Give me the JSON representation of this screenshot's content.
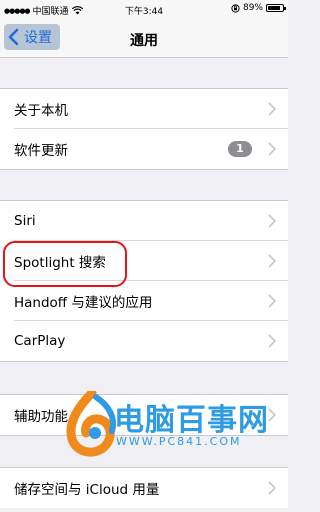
{
  "status_bar": {
    "signal_dots": "●●●●●",
    "carrier": "中国联通",
    "time": "下午3:44",
    "battery_percent": "89%",
    "battery_level": 0.89
  },
  "nav": {
    "back_label": "设置",
    "title": "通用"
  },
  "groups": [
    {
      "items": [
        {
          "label": "关于本机"
        },
        {
          "label": "软件更新",
          "badge": "1"
        }
      ]
    },
    {
      "items": [
        {
          "label": "Siri"
        },
        {
          "label": "Spotlight 搜索"
        },
        {
          "label": "Handoff 与建议的应用"
        },
        {
          "label": "CarPlay"
        }
      ]
    },
    {
      "items": [
        {
          "label": "辅助功能"
        }
      ]
    },
    {
      "items": [
        {
          "label": "储存空间与 iCloud 用量"
        }
      ]
    }
  ],
  "watermark": {
    "name": "电脑百事网",
    "url": "WWW.PC841.COM"
  },
  "colors": {
    "accent": "#1f6ed4",
    "highlight": "#e3141a",
    "watermark": "#2f9be3",
    "badge": "#8e8e93",
    "background": "#efeff4"
  }
}
